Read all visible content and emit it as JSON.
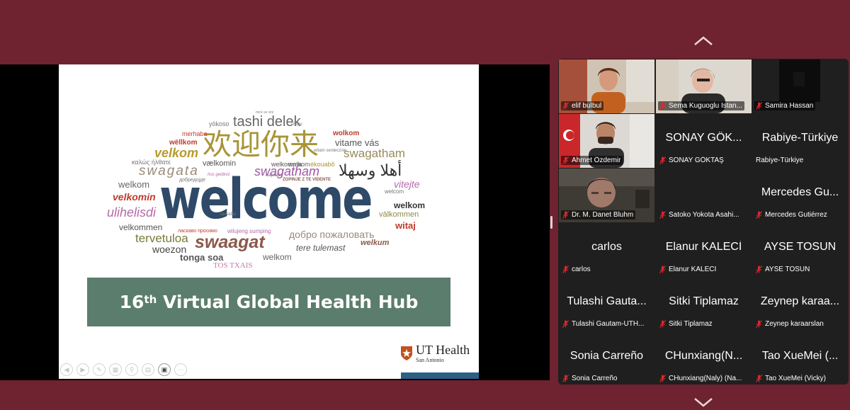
{
  "slide": {
    "wordcloud": {
      "w01": "welcome",
      "w02": "欢迎你来",
      "w03": "tashi delek",
      "w04": "velkom",
      "w05": "swagatham",
      "w06": "swagata",
      "w07": "swagatham",
      "w08": "أهلا وسهلا",
      "w09": "welkom",
      "w10": "velkomin",
      "w11": "ulihelisdi",
      "w12": "velkommen",
      "w13": "tervetuloa",
      "w14": "woezon",
      "w15": "swaagat",
      "w16": "tonga soa",
      "w17": "TOS TXAIS",
      "w18": "welkom",
      "w19": "добро пожаловать",
      "w20": "tere tulemast",
      "w21": "welkum",
      "w22": "witaj",
      "w23": "välkommen",
      "w24": "vitejte",
      "w25": "vitame vás",
      "w26": "wolkom",
      "w27": "wëllkom",
      "w28": "vælkomin",
      "w29": "καλώς ήλθατε",
      "w30": "yōkoso",
      "w31": "mirë se vini",
      "w32": "welkom",
      "w33": "ékouabô",
      "w34": "welkomma",
      "w35": "merhaba",
      "w36": "wilujeng sumping",
      "w37": "ласкаво просимо",
      "w38": "welkom",
      "w39": "мархаба",
      "w40": "ZOPINJE Z TE VIDENTE",
      "w41": "hos geldiniz",
      "w42": "добредојде",
      "w43": "tavyafas",
      "w44": "witam serdecznie",
      "w45": "vitajte",
      "w46": "welcom"
    },
    "banner_pre": "16",
    "banner_sup": "th",
    "banner_post": " Virtual Global Health Hub",
    "logo_line1": "UT Health",
    "logo_line2": "San Antonio"
  },
  "colors": {
    "background": "#6f222f",
    "banner": "#5b7d6d",
    "speaking": "#36c84a",
    "muted_mic": "#e0282f"
  },
  "participants": [
    {
      "name": "elif bulbul",
      "big": "",
      "video": true
    },
    {
      "name": "Sema Kuguoglu Istan...",
      "big": "",
      "video": true
    },
    {
      "name": "Samira Hassan",
      "big": "",
      "video": true
    },
    {
      "name": "Ahmet Özdemir",
      "big": "",
      "video": true
    },
    {
      "name": "SONAY GÖKTAŞ",
      "big": "SONAY GÖK...",
      "video": false
    },
    {
      "name": "Rabiye-Türkiye",
      "big": "Rabiye-Türkiye",
      "video": false
    },
    {
      "name": "Dr. M. Danet Bluhm",
      "big": "",
      "video": true
    },
    {
      "name": "Satoko Yokota Asahi...",
      "big": "",
      "video": false
    },
    {
      "name": "Mercedes Gutiérrez",
      "big": "Mercedes Gu...",
      "video": false
    },
    {
      "name": "carlos",
      "big": "carlos",
      "video": false
    },
    {
      "name": "Elanur KALECİ",
      "big": "Elanur KALECİ",
      "video": false
    },
    {
      "name": "AYSE TOSUN",
      "big": "AYSE TOSUN",
      "video": false
    },
    {
      "name": "Tulashi Gautam-UTH...",
      "big": "Tulashi Gauta...",
      "video": false
    },
    {
      "name": "Sitki Tiplamaz",
      "big": "Sitki Tiplamaz",
      "video": false
    },
    {
      "name": "Zeynep karaarslan",
      "big": "Zeynep karaa...",
      "video": false
    },
    {
      "name": "Sonia Carreño",
      "big": "Sonia Carreño",
      "video": false
    },
    {
      "name": "CHunxiang(Naly) (Na...",
      "big": "CHunxiang(N...",
      "video": false
    },
    {
      "name": "Tao XueMei (Vicky)",
      "big": "Tao XueMei (...",
      "video": false
    }
  ]
}
